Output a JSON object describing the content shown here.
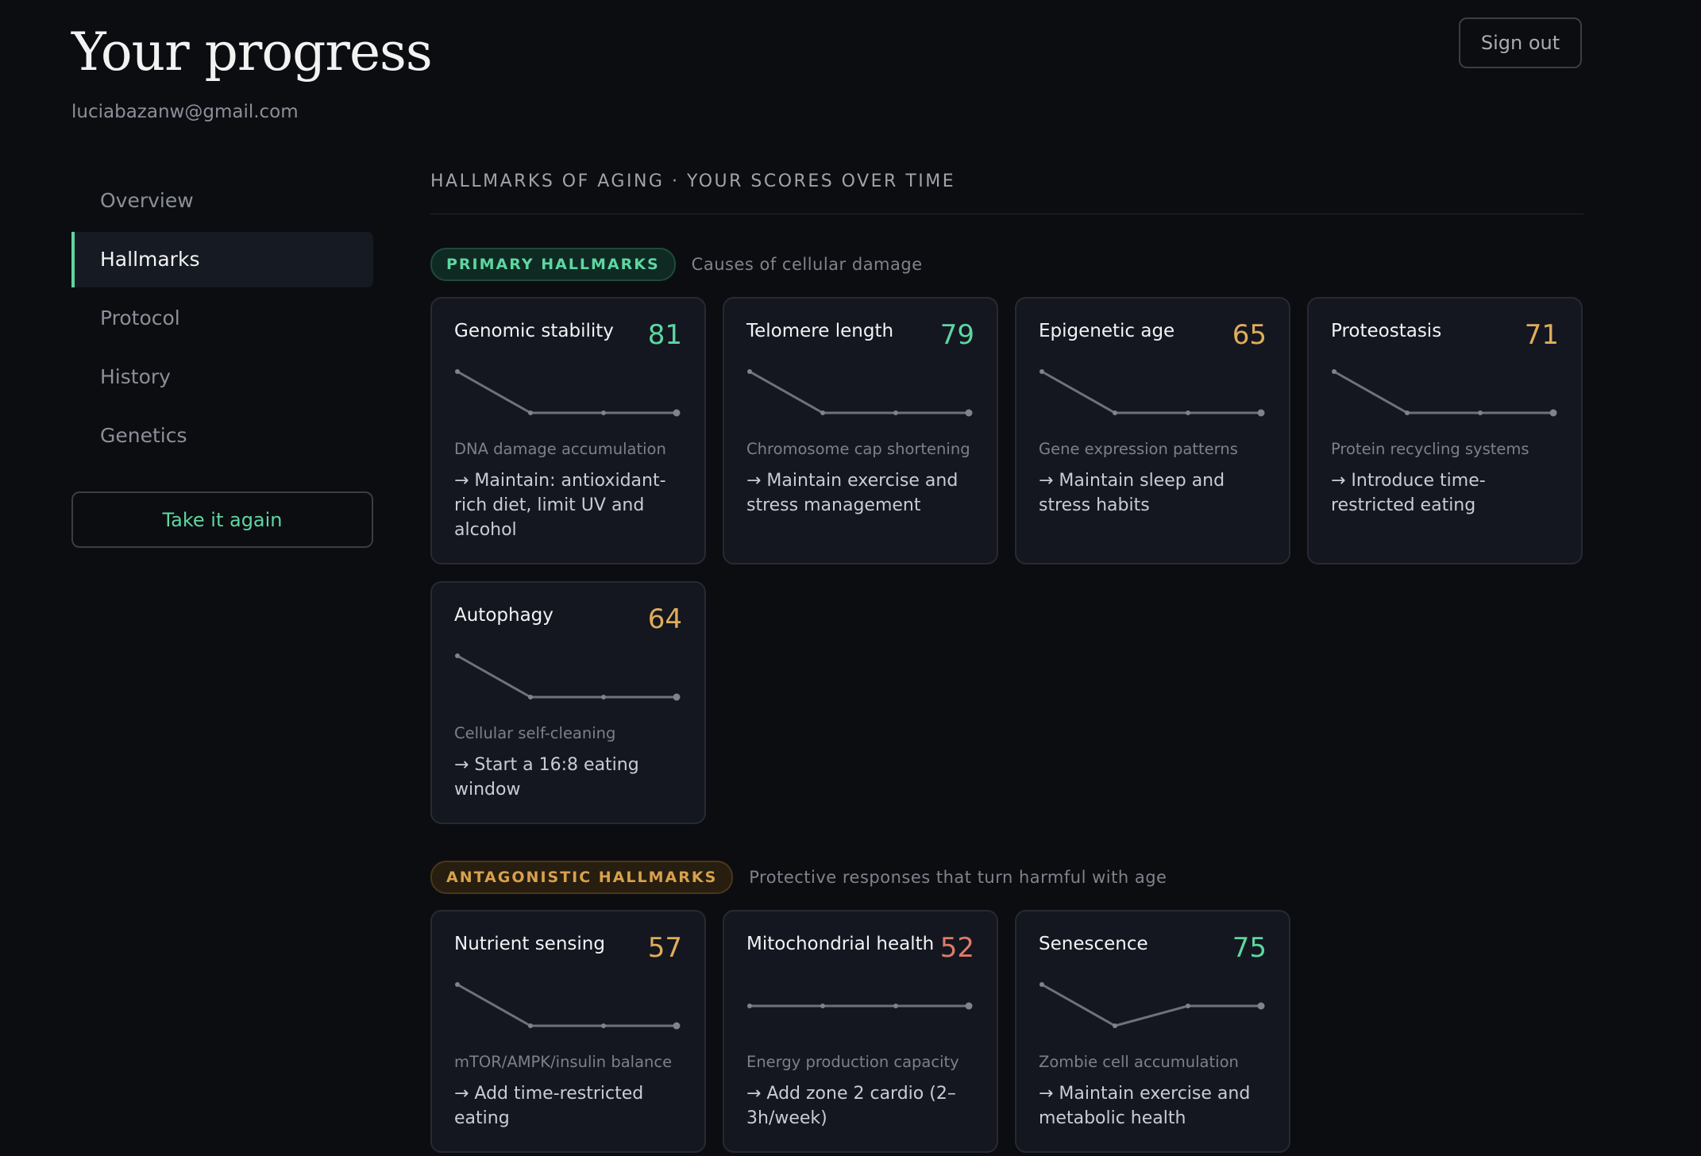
{
  "header": {
    "title": "Your progress",
    "email": "luciabazanw@gmail.com",
    "sign_out": "Sign out"
  },
  "nav": {
    "items": [
      {
        "label": "Overview",
        "active": false
      },
      {
        "label": "Hallmarks",
        "active": true
      },
      {
        "label": "Protocol",
        "active": false
      },
      {
        "label": "History",
        "active": false
      },
      {
        "label": "Genetics",
        "active": false
      }
    ],
    "take_again": "Take it again"
  },
  "main": {
    "section_title": "HALLMARKS OF AGING · YOUR SCORES OVER TIME",
    "groups": [
      {
        "label": "PRIMARY HALLMARKS",
        "subtitle": "Causes of cellular damage",
        "tone": "green",
        "cards": [
          {
            "name": "Genomic stability",
            "score": "81",
            "score_color": "#5ed6a2",
            "trend": [
              3,
              1,
              1,
              1
            ],
            "desc": "DNA damage accumulation",
            "action": "→ Maintain: antioxidant-rich diet, limit UV and alcohol"
          },
          {
            "name": "Telomere length",
            "score": "79",
            "score_color": "#5ed6a2",
            "trend": [
              3,
              1,
              1,
              1
            ],
            "desc": "Chromosome cap shortening",
            "action": "→ Maintain exercise and stress management"
          },
          {
            "name": "Epigenetic age",
            "score": "65",
            "score_color": "#e0ad5b",
            "trend": [
              3,
              1,
              1,
              1
            ],
            "desc": "Gene expression patterns",
            "action": "→ Maintain sleep and stress habits"
          },
          {
            "name": "Proteostasis",
            "score": "71",
            "score_color": "#e0ad5b",
            "trend": [
              3,
              1,
              1,
              1
            ],
            "desc": "Protein recycling systems",
            "action": "→ Introduce time-restricted eating"
          },
          {
            "name": "Autophagy",
            "score": "64",
            "score_color": "#e0ad5b",
            "trend": [
              3,
              1,
              1,
              1
            ],
            "desc": "Cellular self-cleaning",
            "action": "→ Start a 16:8 eating window"
          }
        ]
      },
      {
        "label": "ANTAGONISTIC HALLMARKS",
        "subtitle": "Protective responses that turn harmful with age",
        "tone": "amber",
        "cards": [
          {
            "name": "Nutrient sensing",
            "score": "57",
            "score_color": "#e0ad5b",
            "trend": [
              3,
              1,
              1,
              1
            ],
            "desc": "mTOR/AMPK/insulin balance",
            "action": "→ Add time-restricted eating"
          },
          {
            "name": "Mitochondrial health",
            "score": "52",
            "score_color": "#e07a6a",
            "trend": [
              2,
              2,
              2,
              2
            ],
            "desc": "Energy production capacity",
            "action": "→ Add zone 2 cardio (2–3h/week)"
          },
          {
            "name": "Senescence",
            "score": "75",
            "score_color": "#5ed6a2",
            "trend": [
              3,
              1,
              2,
              2
            ],
            "desc": "Zombie cell accumulation",
            "action": "→ Maintain exercise and metabolic health"
          }
        ]
      }
    ]
  }
}
